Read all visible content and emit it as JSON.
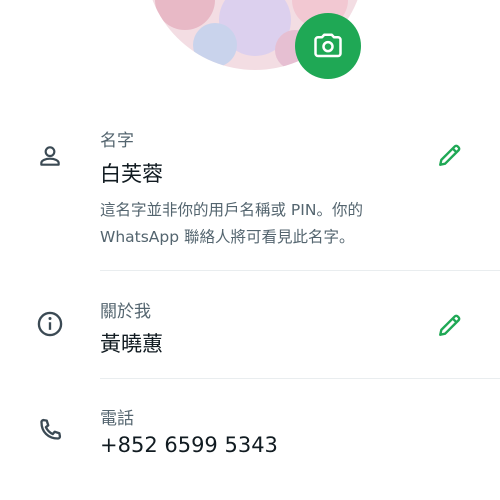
{
  "profile": {
    "avatar_icon": "profile-photo",
    "camera_icon": "camera-icon",
    "accent_color": "#1fa855"
  },
  "name_section": {
    "icon": "person-icon",
    "label": "名字",
    "value": "白芙蓉",
    "help_text": "這名字並非你的用戶名稱或 PIN。你的 WhatsApp 聯絡人將可看見此名字。",
    "edit_icon": "pencil-icon"
  },
  "about_section": {
    "icon": "info-icon",
    "label": "關於我",
    "value": "黃曉蕙",
    "edit_icon": "pencil-icon"
  },
  "phone_section": {
    "icon": "phone-icon",
    "label": "電話",
    "value": "+852 6599 5343"
  }
}
